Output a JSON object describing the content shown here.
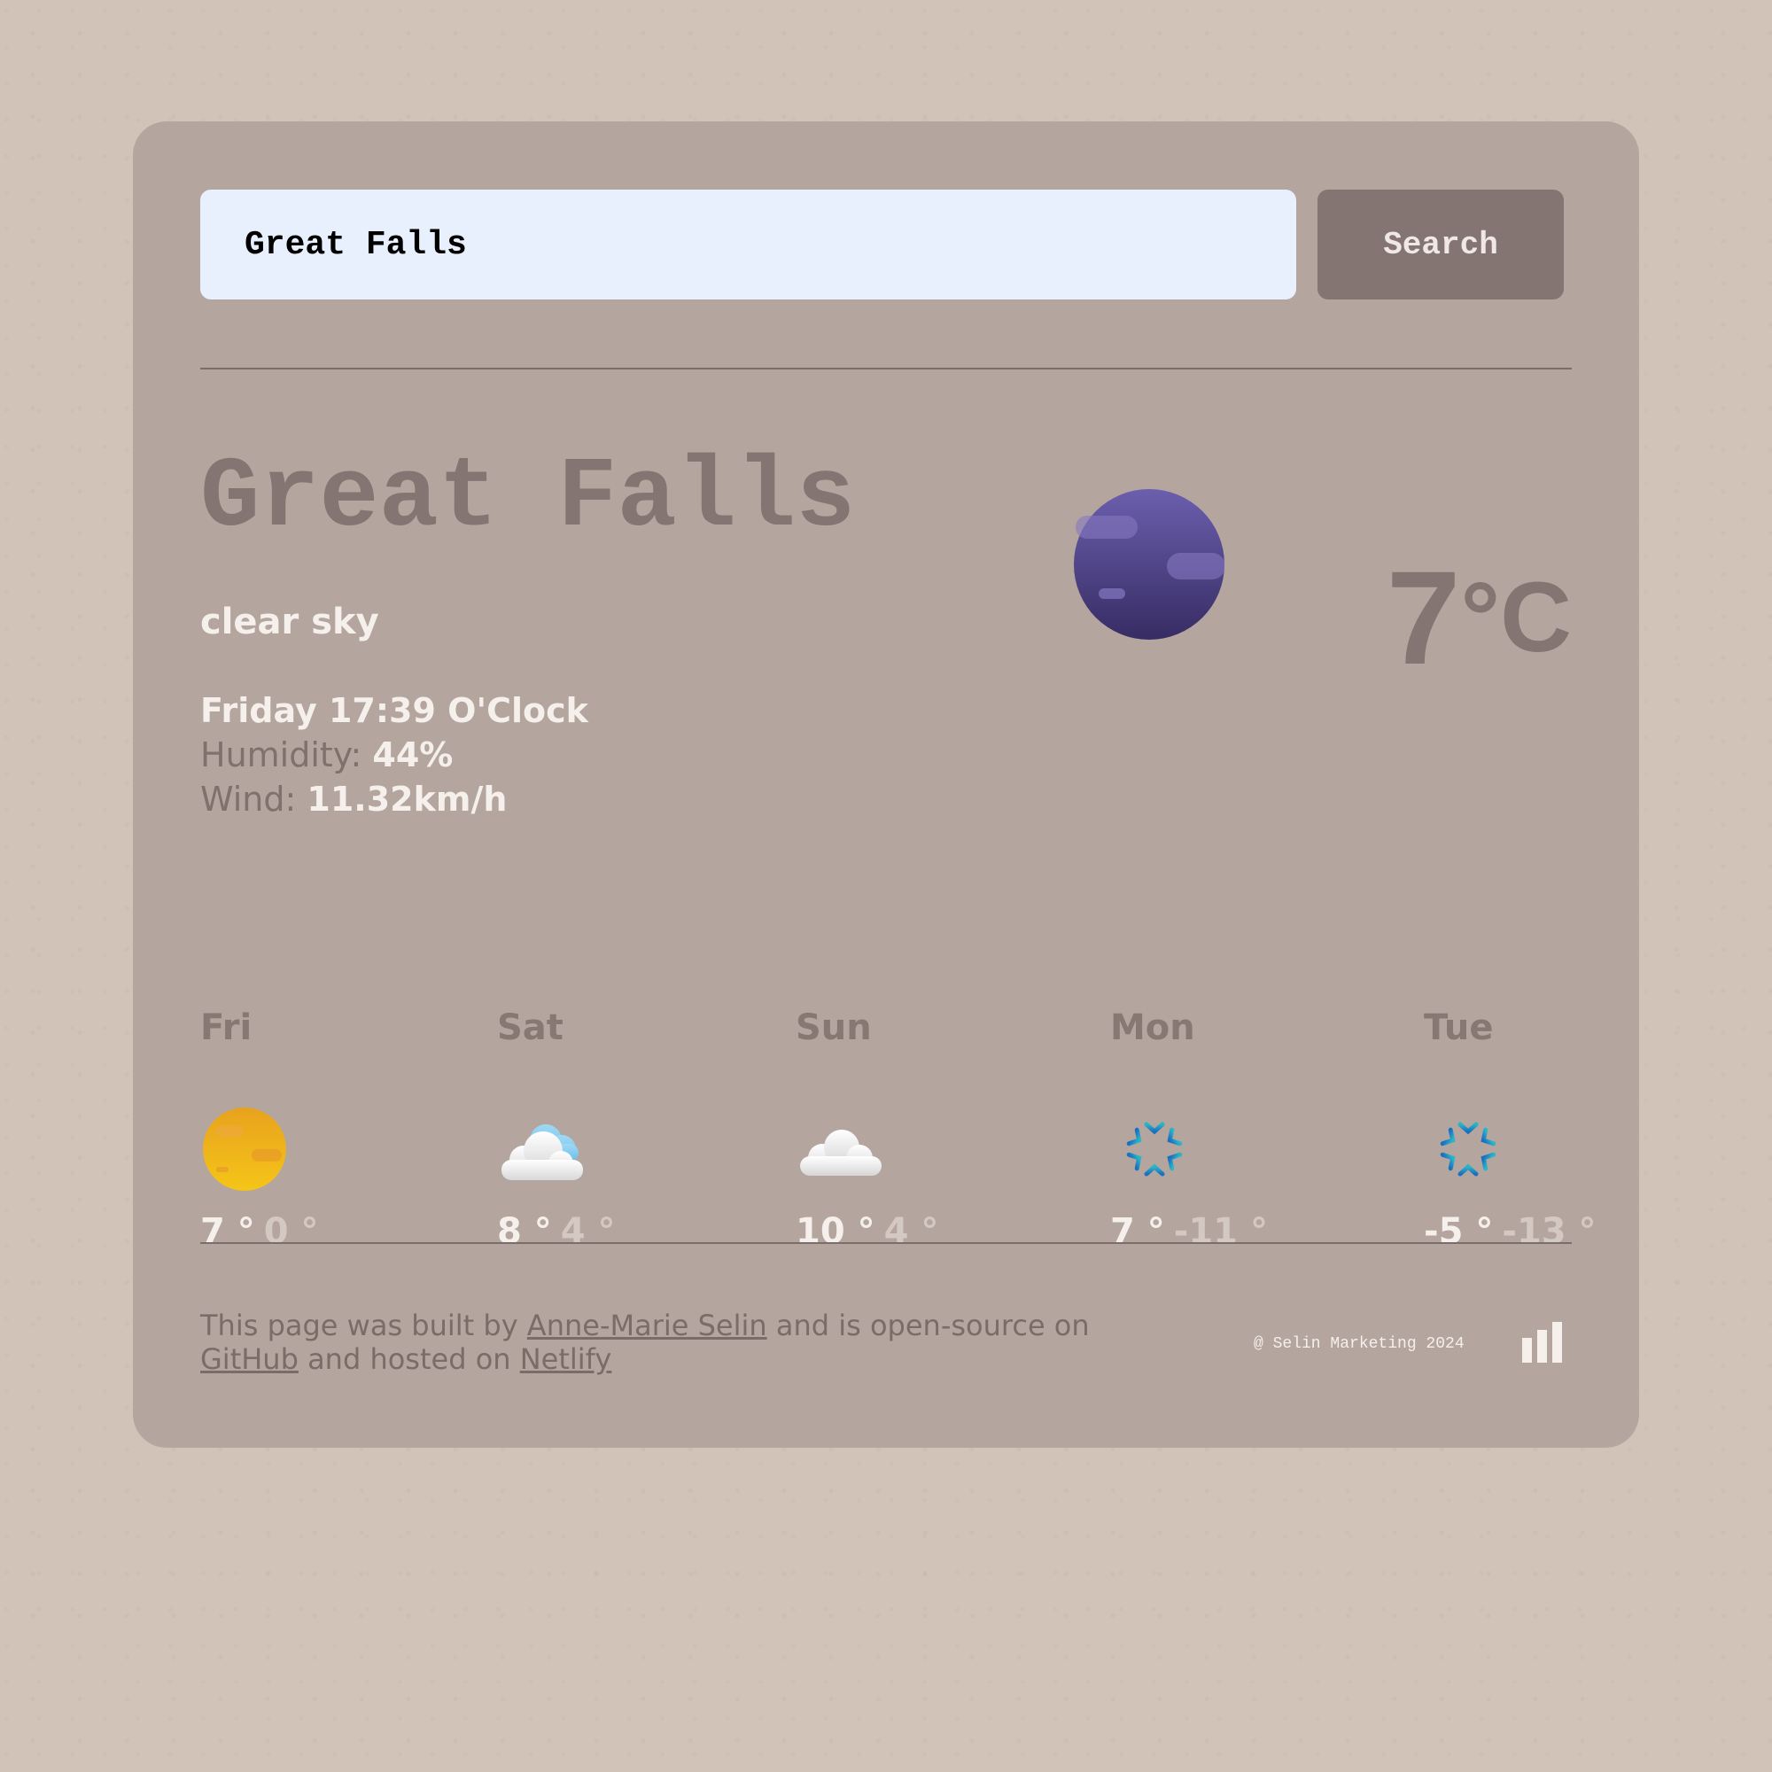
{
  "search": {
    "value": "Great Falls",
    "button_label": "Search"
  },
  "current": {
    "city": "Great Falls",
    "description": "clear sky",
    "datetime": "Friday 17:39 O'Clock",
    "humidity_label": "Humidity: ",
    "humidity_value": "44%",
    "wind_label": "Wind: ",
    "wind_value": "11.32km/h",
    "temperature": "7",
    "unit": "°C",
    "icon": "clear-night-moon-icon"
  },
  "forecast": [
    {
      "day": "Fri",
      "icon": "sun-icon",
      "max": "7 °",
      "min": "0 °"
    },
    {
      "day": "Sat",
      "icon": "partly-cloudy-icon",
      "max": "8 °",
      "min": "4 °"
    },
    {
      "day": "Sun",
      "icon": "cloud-icon",
      "max": "10 °",
      "min": "4 °"
    },
    {
      "day": "Mon",
      "icon": "snowflake-icon",
      "max": "7 °",
      "min": "-11 °"
    },
    {
      "day": "Tue",
      "icon": "snowflake-icon",
      "max": "-5 °",
      "min": "-13 °"
    }
  ],
  "footer": {
    "text_1": "This page was built by ",
    "author_link": "Anne-Marie Selin",
    "text_2": " and is open-source on ",
    "github_link": "GitHub",
    "text_3": " and hosted on ",
    "netlify_link": "Netlify",
    "copyright": "@ Selin Marketing 2024"
  },
  "colors": {
    "page_bg": "#d2c3b9",
    "card_bg": "#b4a59e",
    "accent": "#847472",
    "input_bg": "#e8f0fe",
    "text_light": "#f5f0ec"
  }
}
